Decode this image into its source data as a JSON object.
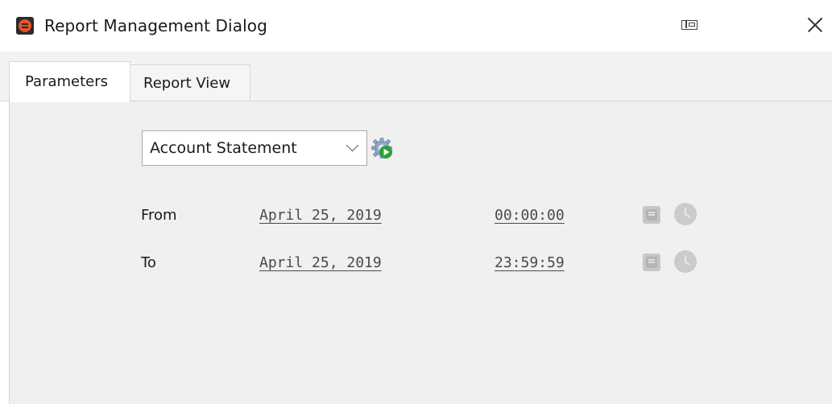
{
  "window": {
    "title": "Report Management Dialog",
    "accent": "#e4542b"
  },
  "tabs": [
    {
      "label": "Parameters",
      "active": true
    },
    {
      "label": "Report View",
      "active": false
    }
  ],
  "report": {
    "selected": "Account Statement"
  },
  "range": {
    "from": {
      "label": "From",
      "date": "April 25, 2019",
      "time": "00:00:00"
    },
    "to": {
      "label": "To",
      "date": "April 25, 2019",
      "time": "23:59:59"
    }
  },
  "icons": {
    "app": "app-logo-icon",
    "restore": "restore-window-icon",
    "close": "close-icon",
    "dropdown": "chevron-down-icon",
    "run": "run-report-gear-icon",
    "calendar": "calendar-icon",
    "clock": "clock-icon"
  }
}
